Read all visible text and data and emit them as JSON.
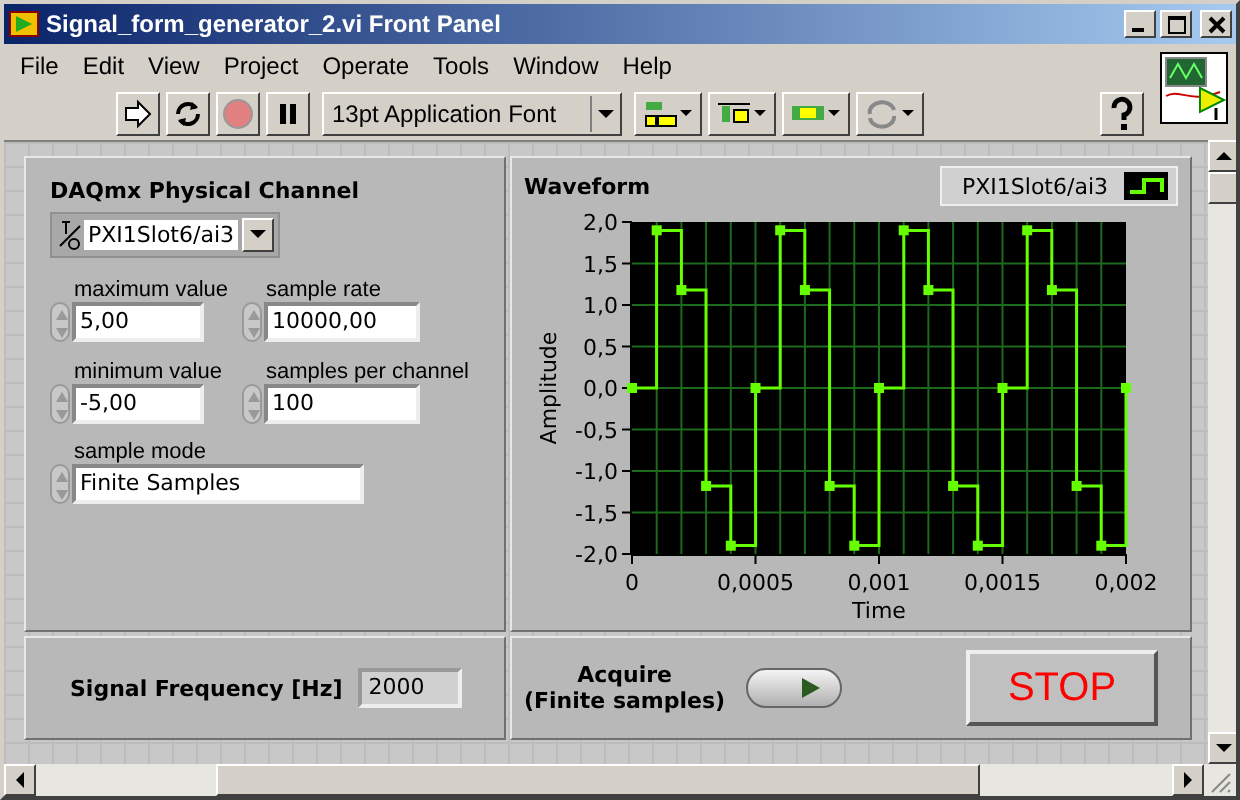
{
  "window": {
    "title": "Signal_form_generator_2.vi Front Panel"
  },
  "menu": [
    "File",
    "Edit",
    "View",
    "Project",
    "Operate",
    "Tools",
    "Window",
    "Help"
  ],
  "toolbar": {
    "font": "13pt Application Font"
  },
  "channel": {
    "label": "DAQmx Physical Channel",
    "value": "PXI1Slot6/ai3"
  },
  "controls": [
    {
      "label": "maximum value",
      "value": "5,00"
    },
    {
      "label": "sample rate",
      "value": "10000,00"
    },
    {
      "label": "minimum value",
      "value": "-5,00"
    },
    {
      "label": "samples per channel",
      "value": "100"
    }
  ],
  "sample_mode": {
    "label": "sample mode",
    "value": "Finite Samples"
  },
  "graph": {
    "title": "Waveform",
    "chart_data": {
      "type": "line",
      "xlabel": "Time",
      "ylabel": "Amplitude",
      "grid": true,
      "x": [
        0,
        0.0001,
        0.0001,
        0.0002,
        0.0002,
        0.0003,
        0.0003,
        0.0004,
        0.0004,
        0.0005,
        0.0005,
        0.0006,
        0.0006,
        0.0007,
        0.0007,
        0.0008,
        0.0008,
        0.0009,
        0.0009,
        0.001,
        0.001,
        0.0011,
        0.0011,
        0.0012,
        0.0012,
        0.0013,
        0.0013,
        0.0014,
        0.0014,
        0.0015,
        0.0015,
        0.0016,
        0.0016,
        0.0017,
        0.0017,
        0.0018,
        0.0018,
        0.0019,
        0.0019,
        0.002,
        0.002
      ],
      "series": [
        {
          "name": "PXI1Slot6/ai3",
          "color": "#66ff00",
          "marker": "square",
          "values": [
            0,
            0,
            1.9,
            1.9,
            1.18,
            1.18,
            -1.18,
            -1.18,
            -1.9,
            -1.9,
            0,
            0,
            1.9,
            1.9,
            1.18,
            1.18,
            -1.18,
            -1.18,
            -1.9,
            -1.9,
            0,
            0,
            1.9,
            1.9,
            1.18,
            1.18,
            -1.18,
            -1.18,
            -1.9,
            -1.9,
            0,
            0,
            1.9,
            1.9,
            1.18,
            1.18,
            -1.18,
            -1.18,
            -1.9,
            -1.9,
            0
          ]
        }
      ],
      "xlim": [
        0,
        0.002
      ],
      "ylim": [
        -2,
        2
      ],
      "xticks": [
        {
          "value": 0,
          "label": "0"
        },
        {
          "value": 0.0005,
          "label": "0,0005"
        },
        {
          "value": 0.001,
          "label": "0,001"
        },
        {
          "value": 0.0015,
          "label": "0,0015"
        },
        {
          "value": 0.002,
          "label": "0,002"
        }
      ],
      "yticks": [
        {
          "value": 2,
          "label": "2,0"
        },
        {
          "value": 1.5,
          "label": "1,5"
        },
        {
          "value": 1,
          "label": "1,0"
        },
        {
          "value": 0.5,
          "label": "0,5"
        },
        {
          "value": 0,
          "label": "0,0"
        },
        {
          "value": -0.5,
          "label": "-0,5"
        },
        {
          "value": -1,
          "label": "-1,0"
        },
        {
          "value": -1.5,
          "label": "-1,5"
        },
        {
          "value": -2,
          "label": "-2,0"
        }
      ]
    }
  },
  "frequency": {
    "label": "Signal Frequency [Hz]",
    "value": "2000"
  },
  "acquire": {
    "label": "Acquire",
    "sublabel": "(Finite samples)",
    "on": false
  },
  "stop": {
    "label": "STOP"
  }
}
